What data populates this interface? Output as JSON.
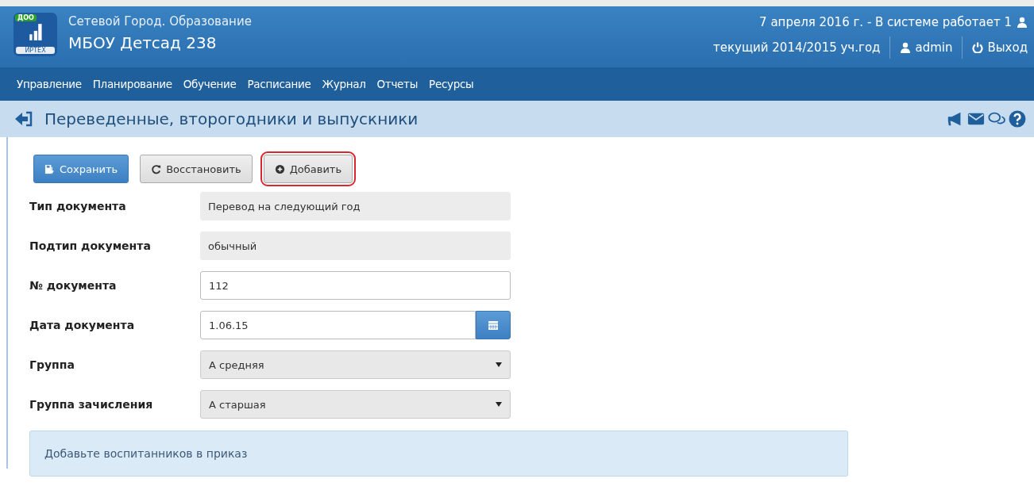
{
  "logo": {
    "badge": "ДОО",
    "caption": "ИРТЕХ"
  },
  "header": {
    "system_name": "Сетевой Город. Образование",
    "org_name": "МБОУ Детсад 238",
    "date_status": "7 апреля 2016 г. - В системе работает 1",
    "year": "текущий 2014/2015 уч.год",
    "user": "admin",
    "logout": "Выход"
  },
  "nav": [
    "Управление",
    "Планирование",
    "Обучение",
    "Расписание",
    "Журнал",
    "Отчеты",
    "Ресурсы"
  ],
  "page_title": "Переведенные, второгодники и выпускники",
  "toolbar": [
    {
      "label": "Сохранить",
      "kind": "primary",
      "highlighted": false
    },
    {
      "label": "Восстановить",
      "kind": "reset",
      "highlighted": false
    },
    {
      "label": "Добавить",
      "kind": "add",
      "highlighted": true
    }
  ],
  "fields": [
    {
      "label": "Тип документа",
      "kind": "readonly",
      "value": "Перевод на следующий год"
    },
    {
      "label": "Подтип документа",
      "kind": "readonly",
      "value": "обычный"
    },
    {
      "label": "№ документа",
      "kind": "input",
      "value": "112"
    },
    {
      "label": "Дата документа",
      "kind": "date",
      "value": "1.06.15"
    },
    {
      "label": "Группа",
      "kind": "select",
      "value": "А средняя"
    },
    {
      "label": "Группа зачисления",
      "kind": "select",
      "value": "А старшая"
    }
  ],
  "notice": "Добавьте воспитанников в приказ"
}
